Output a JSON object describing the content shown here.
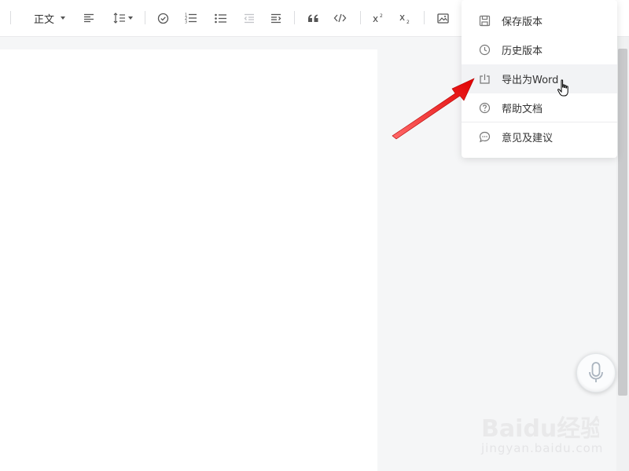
{
  "toolbar": {
    "paragraph_style": "正文",
    "icons": [
      "align-left-icon",
      "line-height-icon",
      "todo-icon",
      "ordered-list-icon",
      "bullet-list-icon",
      "outdent-icon",
      "indent-icon",
      "quote-icon",
      "code-icon",
      "superscript-icon",
      "subscript-icon",
      "image-icon"
    ]
  },
  "menu": {
    "items": [
      {
        "label": "保存版本",
        "icon": "save-icon"
      },
      {
        "label": "历史版本",
        "icon": "clock-icon"
      },
      {
        "label": "导出为Word",
        "icon": "export-icon"
      },
      {
        "label": "帮助文档",
        "icon": "help-icon"
      },
      {
        "label": "意见及建议",
        "icon": "feedback-icon"
      }
    ]
  },
  "mic": {
    "icon": "microphone-icon"
  },
  "watermark": {
    "brand": "Baidu经验",
    "url": "jingyan.baidu.com"
  },
  "colors": {
    "arrow": "#e60000",
    "hover_bg": "#f2f3f5",
    "page_bg": "#f5f6f7"
  }
}
